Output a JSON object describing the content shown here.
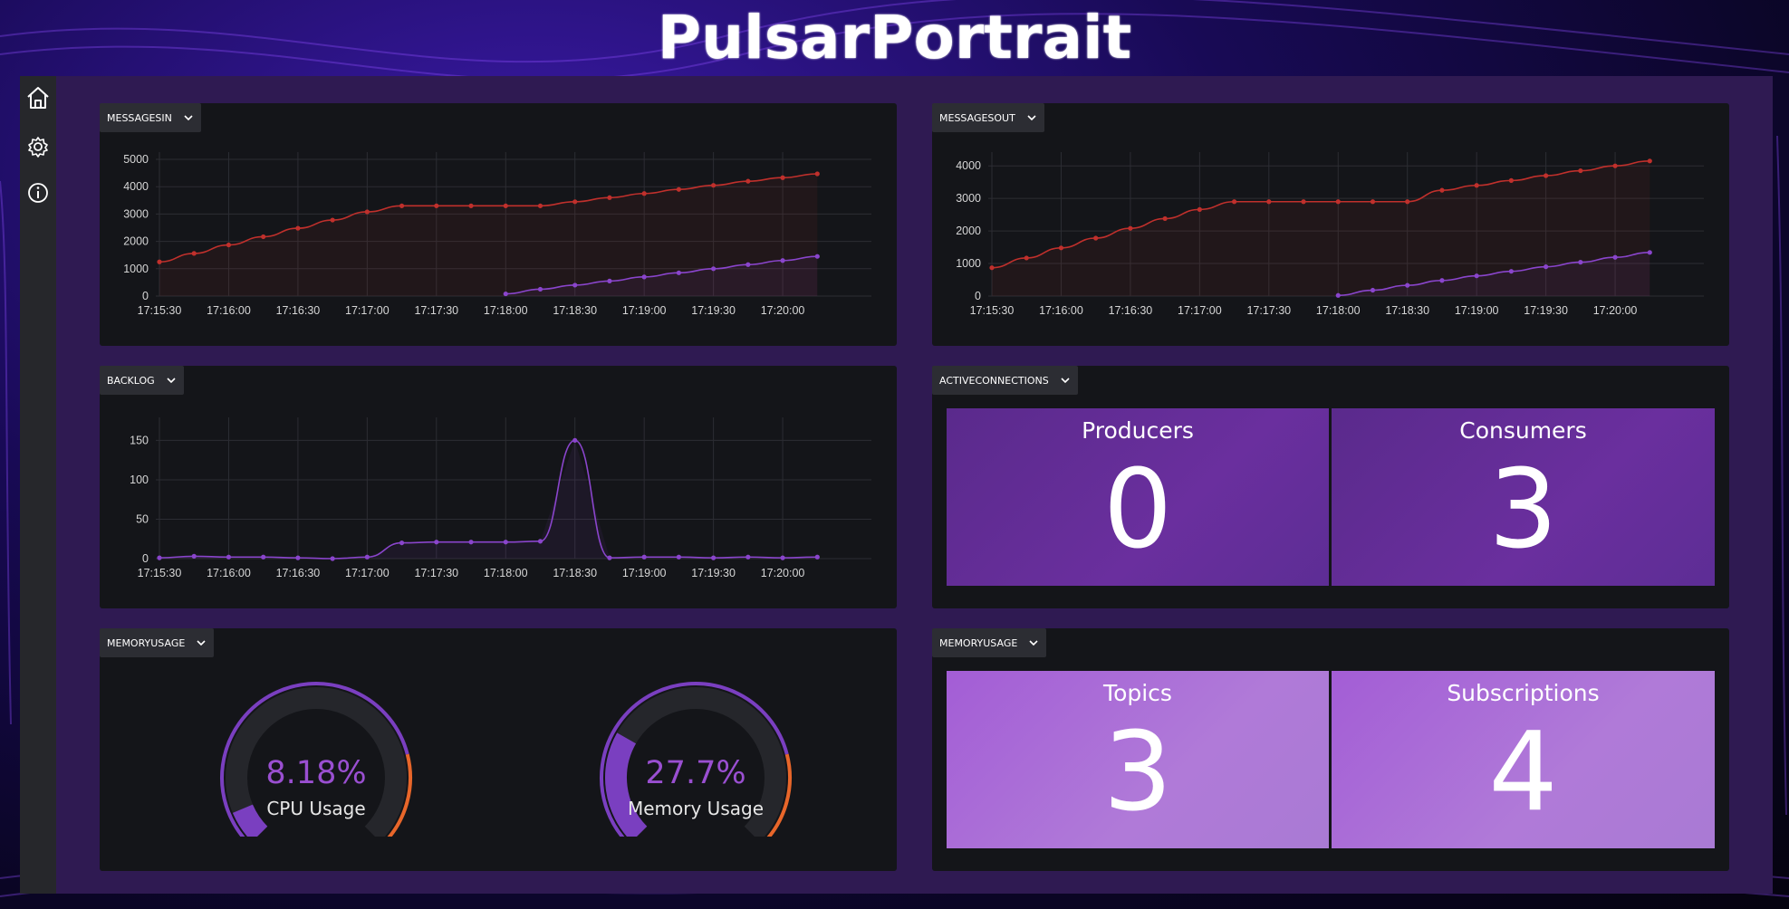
{
  "app": {
    "title": "PulsarPortrait"
  },
  "sidebar": {
    "items": [
      {
        "icon": "home-icon"
      },
      {
        "icon": "gear-icon"
      },
      {
        "icon": "info-icon"
      }
    ]
  },
  "panels": {
    "messagesin": {
      "label": "MESSAGESIN"
    },
    "messagesout": {
      "label": "MESSAGESOUT"
    },
    "backlog": {
      "label": "BACKLOG"
    },
    "activeconnections": {
      "label": "ACTIVECONNECTIONS",
      "producers_label": "Producers",
      "producers_value": "0",
      "consumers_label": "Consumers",
      "consumers_value": "3"
    },
    "memoryusage_gauges": {
      "label": "MEMORYUSAGE",
      "cpu_value": "8.18%",
      "cpu_label": "CPU Usage",
      "cpu_fraction": 0.0818,
      "memory_value": "27.7%",
      "memory_label": "Memory Usage",
      "memory_fraction": 0.277
    },
    "memoryusage_stats": {
      "label": "MEMORYUSAGE",
      "topics_label": "Topics",
      "topics_value": "3",
      "subscriptions_label": "Subscriptions",
      "subscriptions_value": "4"
    }
  },
  "colors": {
    "red_series": "#c0302c",
    "purple_series": "#8a45cc",
    "gauge_orange": "#e8662a",
    "gauge_purple": "#7a3fc0"
  },
  "chart_data": [
    {
      "type": "line",
      "panel": "messagesin",
      "x_ticks": [
        "17:15:30",
        "17:16:00",
        "17:16:30",
        "17:17:00",
        "17:17:30",
        "17:18:00",
        "17:18:30",
        "17:19:00",
        "17:19:30",
        "17:20:00"
      ],
      "y_ticks": [
        0,
        1000,
        2000,
        3000,
        4000,
        5000
      ],
      "ylim": [
        0,
        5000
      ],
      "xlim_seconds": [
        0,
        310
      ],
      "series": [
        {
          "color": "red",
          "x": [
            0,
            15,
            30,
            45,
            60,
            75,
            90,
            105,
            120,
            135,
            150,
            165,
            180,
            195,
            210,
            225,
            240,
            255,
            270,
            285
          ],
          "y": [
            1250,
            1560,
            1870,
            2170,
            2480,
            2780,
            3080,
            3300,
            3300,
            3300,
            3300,
            3300,
            3450,
            3600,
            3750,
            3900,
            4050,
            4200,
            4330,
            4470
          ]
        },
        {
          "color": "purple",
          "x": [
            150,
            165,
            180,
            195,
            210,
            225,
            240,
            255,
            270,
            285
          ],
          "y": [
            80,
            250,
            400,
            550,
            700,
            850,
            1000,
            1150,
            1300,
            1450
          ]
        }
      ]
    },
    {
      "type": "line",
      "panel": "messagesout",
      "x_ticks": [
        "17:15:30",
        "17:16:00",
        "17:16:30",
        "17:17:00",
        "17:17:30",
        "17:18:00",
        "17:18:30",
        "17:19:00",
        "17:19:30",
        "17:20:00"
      ],
      "y_ticks": [
        0,
        1000,
        2000,
        3000,
        4000
      ],
      "ylim": [
        0,
        4200
      ],
      "xlim_seconds": [
        0,
        310
      ],
      "series": [
        {
          "color": "red",
          "x": [
            0,
            15,
            30,
            45,
            60,
            75,
            90,
            105,
            120,
            135,
            150,
            165,
            180,
            195,
            210,
            225,
            240,
            255,
            270,
            285
          ],
          "y": [
            870,
            1170,
            1480,
            1780,
            2080,
            2380,
            2660,
            2900,
            2900,
            2900,
            2900,
            2900,
            2900,
            3250,
            3400,
            3550,
            3700,
            3850,
            4000,
            4150
          ]
        },
        {
          "color": "purple",
          "x": [
            150,
            165,
            180,
            195,
            210,
            225,
            240,
            255,
            270,
            285
          ],
          "y": [
            20,
            180,
            330,
            480,
            620,
            760,
            900,
            1040,
            1190,
            1340
          ]
        }
      ]
    },
    {
      "type": "line",
      "panel": "backlog",
      "x_ticks": [
        "17:15:30",
        "17:16:00",
        "17:16:30",
        "17:17:00",
        "17:17:30",
        "17:18:00",
        "17:18:30",
        "17:19:00",
        "17:19:30",
        "17:20:00"
      ],
      "y_ticks": [
        0,
        50,
        100,
        150
      ],
      "ylim": [
        0,
        170
      ],
      "xlim_seconds": [
        0,
        310
      ],
      "series": [
        {
          "color": "purple",
          "x": [
            0,
            15,
            30,
            45,
            60,
            75,
            90,
            105,
            120,
            135,
            150,
            165,
            180,
            195,
            210,
            225,
            240,
            255,
            270,
            285
          ],
          "y": [
            1,
            3,
            2,
            2,
            1,
            0,
            2,
            20,
            21,
            21,
            21,
            22,
            150,
            1,
            2,
            2,
            1,
            2,
            1,
            2
          ]
        }
      ]
    }
  ]
}
